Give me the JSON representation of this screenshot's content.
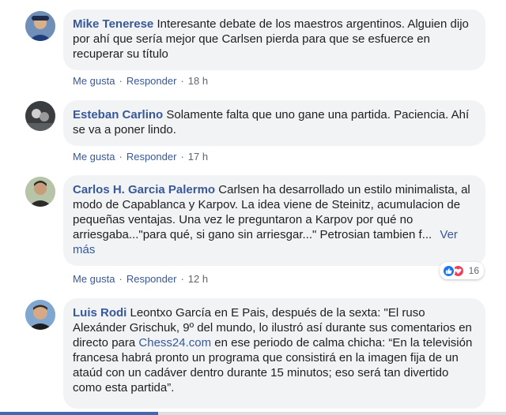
{
  "comments": [
    {
      "author": "Mike Tenerese",
      "text": "Interesante debate de los maestros argentinos. Alguien dijo por ahí que sería mejor que Carlsen pierda para que se esfuerce en recuperar su título",
      "like": "Me gusta",
      "reply": "Responder",
      "time": "18 h"
    },
    {
      "author": "Esteban Carlino",
      "text": "Solamente falta que uno gane una partida. Paciencia. Ahí se va a poner lindo.",
      "like": "Me gusta",
      "reply": "Responder",
      "time": "17 h"
    },
    {
      "author": "Carlos H. Garcia Palermo",
      "text": "Carlsen ha desarrollado un estilo minimalista, al modo de Capablanca y Karpov. La idea viene de Steinitz, acumulacion de pequeñas ventajas. Una vez le preguntaron a Karpov por qué no arriesgaba...\"para qué, si gano sin arriesgar...\" Petrosian tambien f...",
      "see_more": "Ver más",
      "like": "Me gusta",
      "reply": "Responder",
      "time": "12 h",
      "reaction_count": "16"
    },
    {
      "author": "Luis Rodi",
      "text_before_link": "Leontxo García en E Pais, después de la sexta: \"El ruso Alexánder Grischuk, 9º del mundo, lo ilustró así durante sus comentarios en directo para ",
      "link": "Chess24.com",
      "text_after_link": " en ese periodo de calma chicha: “En la televisión francesa habrá pronto un programa que consistirá en la imagen fija de un ataúd con un cadáver dentro durante 15 minutos; eso será tan divertido como esta partida”."
    }
  ],
  "separator": "·",
  "icons": {
    "like": "thumbs-up-icon",
    "love": "heart-icon"
  },
  "colors": {
    "author": "#385898",
    "bubble": "#f2f3f5",
    "like": "#1877f2",
    "love": "#f33e58"
  }
}
